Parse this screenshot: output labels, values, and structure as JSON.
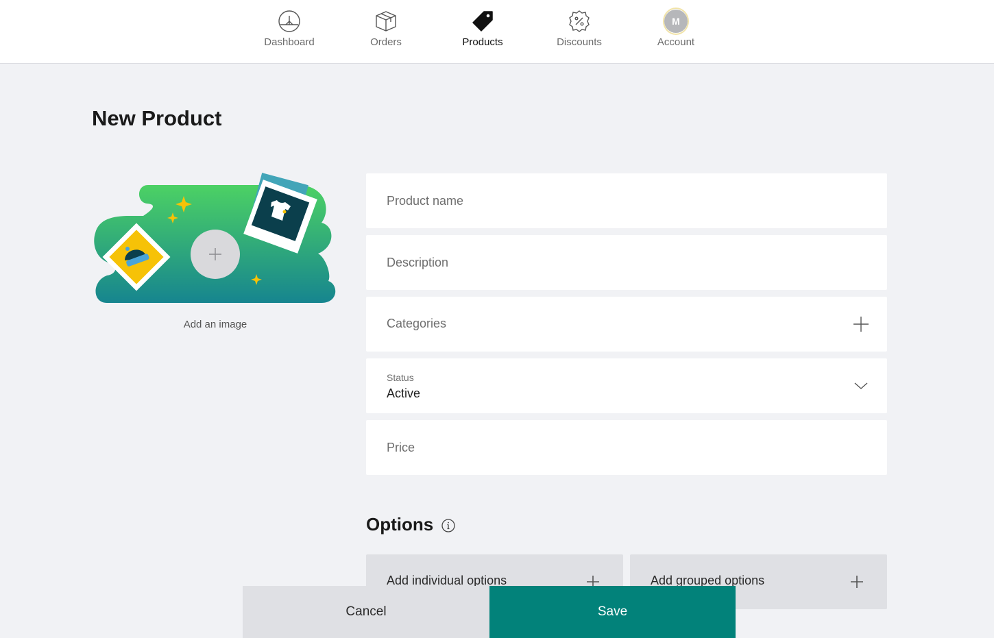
{
  "nav": {
    "items": [
      {
        "label": "Dashboard",
        "icon": "gauge-icon"
      },
      {
        "label": "Orders",
        "icon": "box-icon"
      },
      {
        "label": "Products",
        "icon": "tag-icon",
        "active": true
      },
      {
        "label": "Discounts",
        "icon": "discount-badge-icon"
      },
      {
        "label": "Account",
        "icon": "avatar",
        "initial": "M"
      }
    ]
  },
  "page": {
    "title": "New Product"
  },
  "image_upload": {
    "label": "Add an image"
  },
  "form": {
    "product_name": {
      "placeholder": "Product name",
      "value": ""
    },
    "description": {
      "placeholder": "Description",
      "value": ""
    },
    "categories": {
      "label": "Categories"
    },
    "status": {
      "label": "Status",
      "value": "Active"
    },
    "price": {
      "placeholder": "Price",
      "value": ""
    }
  },
  "options": {
    "title": "Options",
    "individual_label": "Add individual options",
    "grouped_label": "Add grouped options"
  },
  "footer": {
    "cancel_label": "Cancel",
    "save_label": "Save"
  },
  "colors": {
    "accent": "#02827a",
    "background": "#f1f2f5",
    "illustration_gradient_top": "#4cd164",
    "illustration_gradient_bottom": "#16858f",
    "sparkle": "#f6c207"
  }
}
